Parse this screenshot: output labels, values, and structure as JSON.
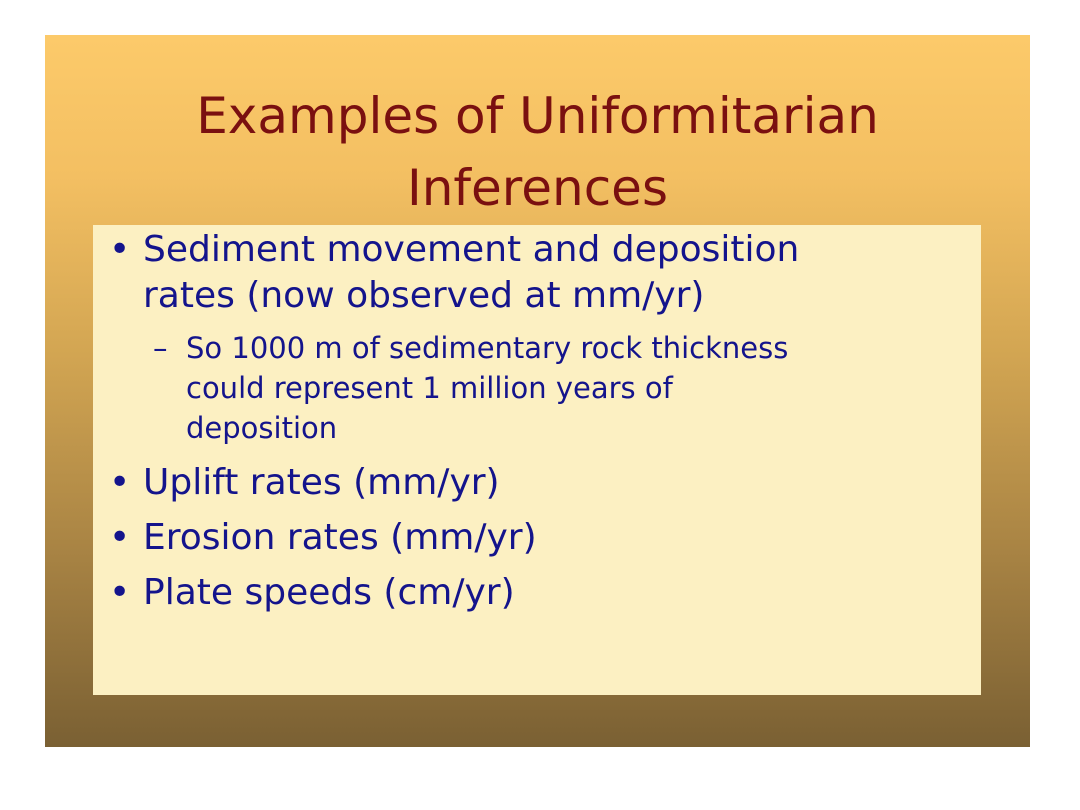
{
  "slide": {
    "title_lines": [
      "Examples of Uniformitarian",
      "Inferences"
    ],
    "bullet_marker": "•",
    "sub_marker": "–",
    "bullets": [
      {
        "lines": [
          "Sediment movement and deposition",
          "rates (now observed at mm/yr)"
        ],
        "sub_items": [
          {
            "lines": [
              "So 1000 m of sedimentary rock thickness",
              "could represent 1 million years of",
              "deposition"
            ]
          }
        ]
      },
      {
        "lines": [
          "Uplift rates (mm/yr)"
        ]
      },
      {
        "lines": [
          "Erosion rates (mm/yr)"
        ]
      },
      {
        "lines": [
          "Plate speeds (cm/yr)"
        ]
      }
    ]
  },
  "colors": {
    "title": "#7a1010",
    "body_text": "#14148c",
    "content_box": "#fcf0c2",
    "background_top": "#fcca6a",
    "background_bottom": "#7a6033"
  }
}
